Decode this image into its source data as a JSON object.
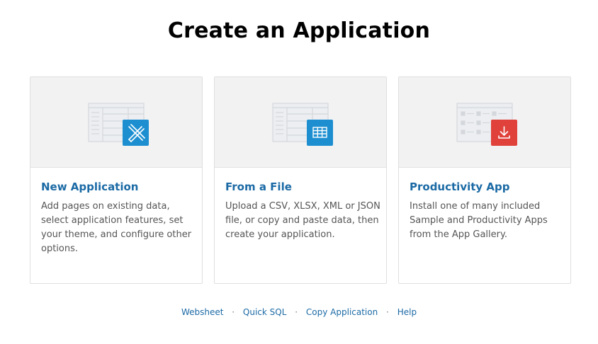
{
  "page_title": "Create an Application",
  "cards": [
    {
      "title": "New Application",
      "description": "Add pages on existing data, select application features, set your theme, and configure other options.",
      "icon": "pencil-ruler-icon",
      "icon_color": "#1d8fd1"
    },
    {
      "title": "From a File",
      "description": "Upload a CSV, XLSX, XML or JSON file, or copy and paste data, then create your application.",
      "icon": "table-grid-icon",
      "icon_color": "#1d8fd1"
    },
    {
      "title": "Productivity App",
      "description": "Install one of many included Sample and Productivity Apps from the App Gallery.",
      "icon": "download-icon",
      "icon_color": "#e0413a"
    }
  ],
  "footer": {
    "separator": "·",
    "links": [
      "Websheet",
      "Quick SQL",
      "Copy Application",
      "Help"
    ]
  }
}
